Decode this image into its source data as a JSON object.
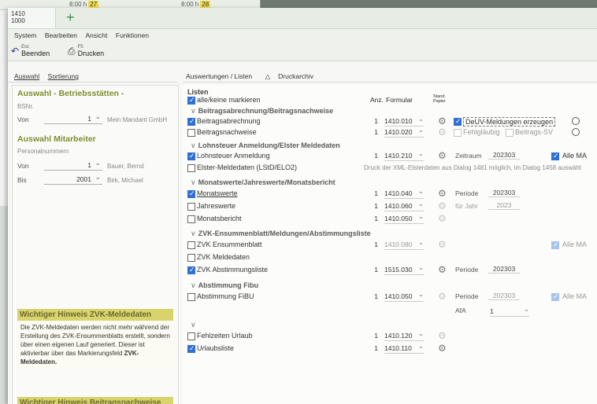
{
  "bg_window": {
    "cal1": "8:00 h",
    "cal1_badge": "27",
    "cal2": "8:00 h",
    "cal2_badge": "28"
  },
  "tab": {
    "line1": "1410",
    "line2": "1000"
  },
  "menu": [
    "System",
    "Bearbeiten",
    "Ansicht",
    "Funktionen"
  ],
  "toolbar": {
    "exit_key": "Esc",
    "exit_label": "Beenden",
    "print_key": "F5",
    "print_label": "Drucken"
  },
  "left_tabs": [
    "Auswahl",
    "Sortierung"
  ],
  "left": {
    "bst_title": "Auswahl - Betriebsstätten -",
    "bst_sub": "BSNr.",
    "von_label": "Von",
    "von_value": "1",
    "von_name": "Mein Mandant GmbH",
    "ma_title": "Auswahl Mitarbeiter",
    "ma_sub": "Personalnummern",
    "ma_von_label": "Von",
    "ma_von_value": "1",
    "ma_von_name": "Bauer, Bernd",
    "bis_label": "Bis",
    "bis_value": "2001",
    "bis_name": "Birk, Michael",
    "hint1_title": "Wichtiger Hinweis ZVK-Meldedaten",
    "hint1_body": "Die ZVK-Meldedaten werden nicht mehr während der Erstellung des ZVK-Ensummenblatts erstellt, sondern über einen eigenen Lauf generiert. Dieser ist aktivierbar über das Markierungsfeld",
    "hint1_bold": "ZVK-Meldedaten.",
    "hint2_title": "Wichtiger Hinweis Beitragsnachweise"
  },
  "right_tabs": [
    "Auswertungen / Listen",
    "Druckarchiv"
  ],
  "list": {
    "header": "Listen",
    "select_all": "alle/keine markieren",
    "col_anz": "Anz.",
    "col_form": "Formular",
    "col_std": "Stand. Papier",
    "groups": [
      "Beitragsabrechnung/Beitragsnachweise",
      "Lohnsteuer Anmeldung/Elster Meldedaten",
      "Monatswerte/Jahreswerte/Monatsbericht",
      "ZVK-Ensummenblatt/Meldungen/Abstimmungsliste",
      "Abstimmung Fibu"
    ],
    "rows": {
      "r1": {
        "label": "Beitragsabrechnung",
        "anz": "1",
        "form": "1410.010"
      },
      "r2": {
        "label": "Beitragsnachweise",
        "anz": "1",
        "form": "1410.020"
      },
      "r3": {
        "label": "Lohnsteuer Anmeldung",
        "anz": "1",
        "form": "1410.210"
      },
      "r4": {
        "label": "Elster-Meldedaten (LStD/ELO2)",
        "note": "Druck der XML-Elsterdaten aus Dialog 1481 möglich, im Dialog 1458 auswähl"
      },
      "r5": {
        "label": "Monatswerte",
        "anz": "1",
        "form": "1410.040"
      },
      "r6": {
        "label": "Jahreswerte",
        "anz": "1",
        "form": "1410.060"
      },
      "r7": {
        "label": "Monatsbericht",
        "anz": "1",
        "form": "1410.050"
      },
      "r8": {
        "label": "ZVK Ensummenblatt",
        "anz": "1",
        "form": "1410.080"
      },
      "r9": {
        "label": "ZVK Meldedaten"
      },
      "r10": {
        "label": "ZVK Abstimmungsliste",
        "anz": "1",
        "form": "1515.030"
      },
      "r11": {
        "label": "Abstimmung FiBU",
        "anz": "1",
        "form": "1410.050"
      },
      "r12": {
        "label": "Fehlzeiten Urlaub",
        "anz": "1",
        "form": "1410.120"
      },
      "r13": {
        "label": "Urlaubsliste",
        "anz": "1",
        "form": "1410.110"
      }
    },
    "r1_extra": {
      "deuv": "DeUV-Meldungen erzeugen"
    },
    "r2_extra": {
      "a": "Fehlgläubig",
      "b": "Beitrags-SV"
    },
    "r3_extra": {
      "zeitraum_label": "Zeitraum",
      "zeitraum_value": "202303",
      "alle_ma": "Alle MA"
    },
    "r5_extra": {
      "periode_label": "Periode",
      "periode_value": "202303"
    },
    "r6_extra": {
      "jahr_label": "für Jahr",
      "jahr_value": "2023"
    },
    "r8_extra": {
      "alle_ma": "Alle MA"
    },
    "r10_extra": {
      "periode_label": "Periode",
      "periode_value": "202303"
    },
    "r11_extra": {
      "periode_label": "Periode",
      "periode_value": "202303",
      "alle_ma": "Alle MA",
      "afa_label": "AfA",
      "afa_value": "1"
    }
  }
}
